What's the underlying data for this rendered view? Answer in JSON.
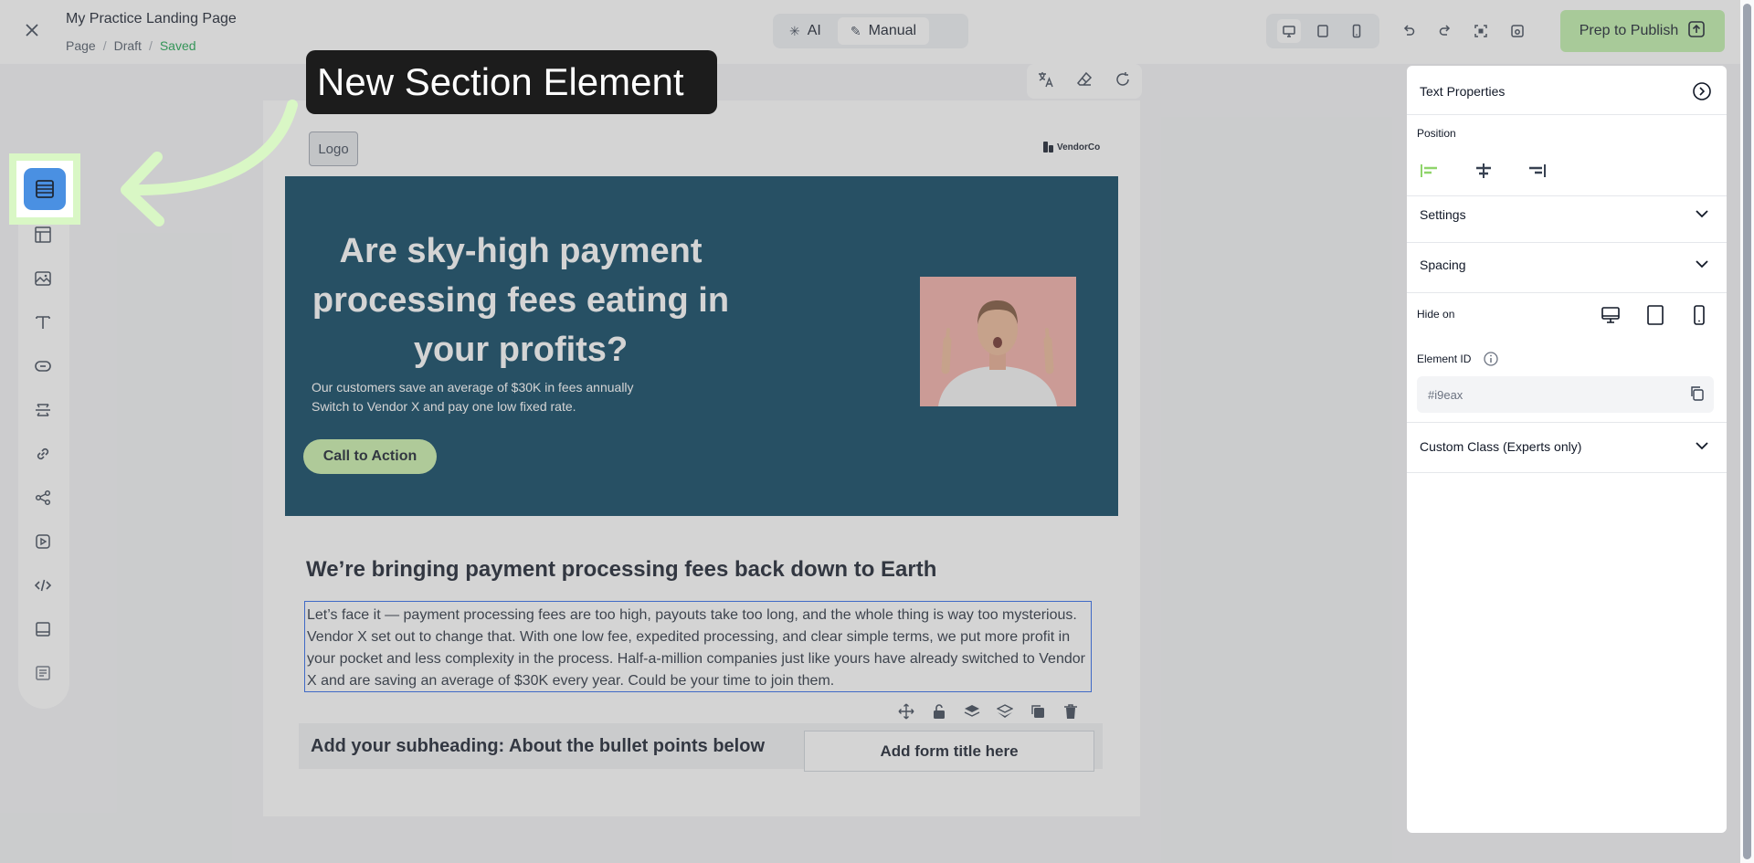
{
  "header": {
    "page_title": "My Practice Landing Page",
    "breadcrumb": [
      "Page",
      "Draft",
      "Saved"
    ],
    "modes": [
      {
        "label": "AI"
      },
      {
        "label": "Manual"
      }
    ],
    "publish_label": "Prep to Publish"
  },
  "canvas": {
    "logo_label": "Logo",
    "vendor_logo_text": "VendorCo",
    "hero": {
      "title": "Are sky-high payment processing fees eating in your profits?",
      "sub_line1": "Our customers save an average of $30K in fees annually",
      "sub_line2": "Switch to Vendor X and pay one low fixed rate.",
      "cta_label": "Call to Action"
    },
    "section_title": "We’re bringing payment processing fees back down to Earth",
    "body": "Let’s face it — payment processing fees are too high, payouts take too long, and the whole thing is way too mysterious. Vendor X set out to change that. With one low fee, expedited processing, and clear simple terms, we put more profit in your pocket and less complexity in the process. Half-a-million companies just like yours have already switched to Vendor X and are saving an average of $30K every year. Could be your time to join them.",
    "subheading": "Add your subheading: About the bullet points below",
    "form_title": "Add form title here"
  },
  "panel": {
    "title": "Text Properties",
    "position_label": "Position",
    "settings_label": "Settings",
    "spacing_label": "Spacing",
    "hide_on_label": "Hide on",
    "element_id_label": "Element ID",
    "element_id_value": "#i9eax",
    "custom_class_label": "Custom Class (Experts only)"
  },
  "annotation": {
    "tooltip": "New Section Element"
  },
  "colors": {
    "accent_green": "#bff0a8",
    "hero_bg": "#003d5b",
    "section_btn": "#4a90e2",
    "selection": "#2563eb",
    "saved": "#16a34a"
  }
}
